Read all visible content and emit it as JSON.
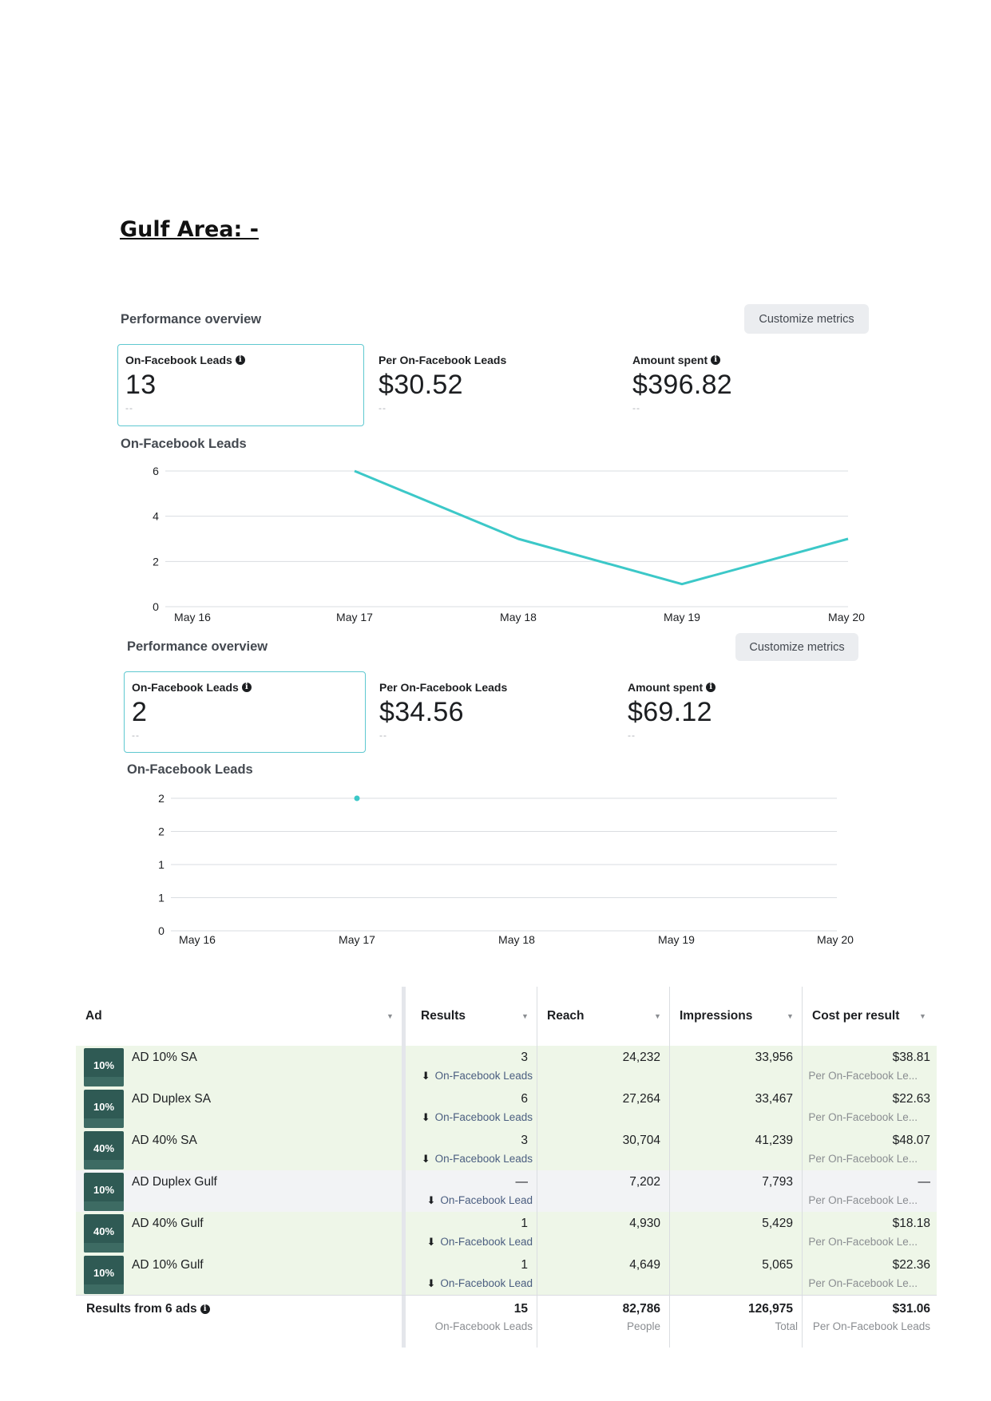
{
  "doc_title": "Gulf Area: -",
  "panels": [
    {
      "po_title": "Performance overview",
      "customize": "Customize metrics",
      "metrics": [
        {
          "label": "On-Facebook Leads",
          "value": "13",
          "sub": "--",
          "info": true
        },
        {
          "label": "Per On-Facebook Leads",
          "value": "$30.52",
          "sub": "--",
          "info": false
        },
        {
          "label": "Amount spent",
          "value": "$396.82",
          "sub": "--",
          "info": true
        }
      ],
      "chart_title": "On-Facebook Leads"
    },
    {
      "po_title": "Performance overview",
      "customize": "Customize metrics",
      "metrics": [
        {
          "label": "On-Facebook Leads",
          "value": "2",
          "sub": "--",
          "info": true
        },
        {
          "label": "Per On-Facebook Leads",
          "value": "$34.56",
          "sub": "--",
          "info": false
        },
        {
          "label": "Amount spent",
          "value": "$69.12",
          "sub": "--",
          "info": true
        }
      ],
      "chart_title": "On-Facebook Leads"
    }
  ],
  "chart_data": [
    {
      "type": "line",
      "categories": [
        "May 16",
        "May 17",
        "May 18",
        "May 19",
        "May 20"
      ],
      "series": [
        {
          "values": [
            null,
            6,
            3,
            1,
            3
          ]
        }
      ],
      "yticks": [
        "0",
        "2",
        "4",
        "6"
      ],
      "ylim": [
        0,
        6
      ],
      "color": "#3cc8c8",
      "grid": true
    },
    {
      "type": "line",
      "categories": [
        "May 16",
        "May 17",
        "May 18",
        "May 19",
        "May 20"
      ],
      "series": [
        {
          "values": [
            null,
            2,
            null,
            null,
            null
          ]
        }
      ],
      "yticks": [
        "0",
        "1",
        "1",
        "2",
        "2"
      ],
      "ylim": [
        0,
        2
      ],
      "color": "#3cc8c8",
      "grid": true
    }
  ],
  "table": {
    "headers": [
      "Ad",
      "Results",
      "Reach",
      "Impressions",
      "Cost per result"
    ],
    "rows": [
      {
        "name": "AD 10% SA",
        "thumb": "10%",
        "results": "3",
        "results_sub": "On-Facebook Leads",
        "reach": "24,232",
        "impressions": "33,956",
        "cost": "$38.81",
        "cost_sub": "Per On-Facebook Le...",
        "style": "green"
      },
      {
        "name": "AD Duplex SA",
        "thumb": "10%",
        "results": "6",
        "results_sub": "On-Facebook Leads",
        "reach": "27,264",
        "impressions": "33,467",
        "cost": "$22.63",
        "cost_sub": "Per On-Facebook Le...",
        "style": "green"
      },
      {
        "name": "AD 40% SA",
        "thumb": "40%",
        "results": "3",
        "results_sub": "On-Facebook Leads",
        "reach": "30,704",
        "impressions": "41,239",
        "cost": "$48.07",
        "cost_sub": "Per On-Facebook Le...",
        "style": "green"
      },
      {
        "name": "AD Duplex Gulf",
        "thumb": "10%",
        "results": "—",
        "results_sub": "On-Facebook Lead",
        "reach": "7,202",
        "impressions": "7,793",
        "cost": "—",
        "cost_sub": "Per On-Facebook Le...",
        "style": "grey"
      },
      {
        "name": "AD 40% Gulf",
        "thumb": "40%",
        "results": "1",
        "results_sub": "On-Facebook Lead",
        "reach": "4,930",
        "impressions": "5,429",
        "cost": "$18.18",
        "cost_sub": "Per On-Facebook Le...",
        "style": "green"
      },
      {
        "name": "AD 10% Gulf",
        "thumb": "10%",
        "results": "1",
        "results_sub": "On-Facebook Lead",
        "reach": "4,649",
        "impressions": "5,065",
        "cost": "$22.36",
        "cost_sub": "Per On-Facebook Le...",
        "style": "green"
      }
    ],
    "footer": {
      "label": "Results from 6 ads",
      "results": "15",
      "results_sub": "On-Facebook Leads",
      "reach": "82,786",
      "reach_sub": "People",
      "impressions": "126,975",
      "impressions_sub": "Total",
      "cost": "$31.06",
      "cost_sub": "Per On-Facebook Leads"
    }
  }
}
